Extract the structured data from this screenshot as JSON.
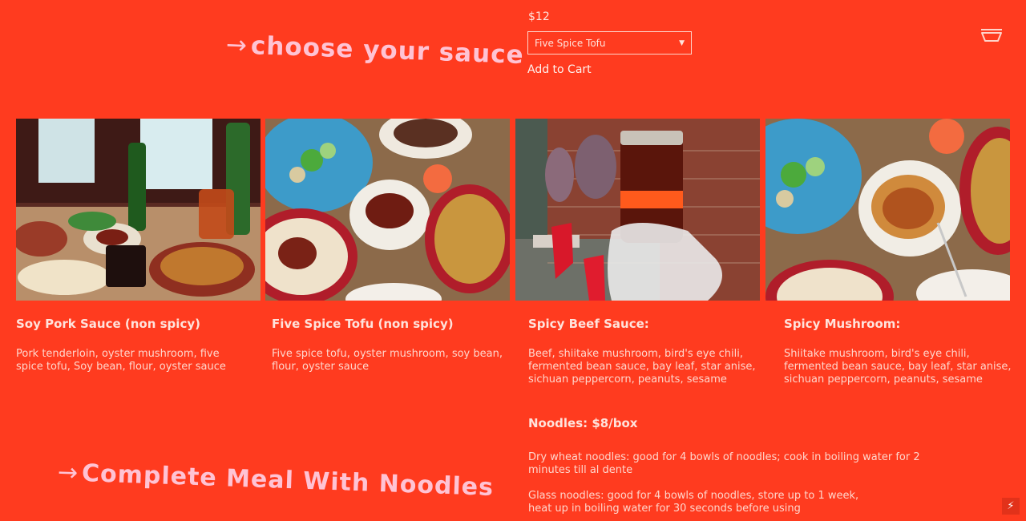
{
  "headings": {
    "arrow": "→",
    "sauce": "choose your sauce",
    "meal": "Complete Meal With Noodles"
  },
  "product": {
    "price": "$12",
    "selected_option": "Five Spice Tofu",
    "add_to_cart": "Add to Cart"
  },
  "icons": {
    "cart": "bowl-cart-icon",
    "badge": "lightning-icon"
  },
  "badge": {
    "glyph": "⚡"
  },
  "sauces": [
    {
      "title": "Soy Pork Sauce (non spicy)",
      "description": "Pork tenderloin, oyster mushroom, five spice tofu, Soy bean, flour, oyster sauce"
    },
    {
      "title": "Five Spice Tofu (non spicy)",
      "description": "Five spice tofu, oyster mushroom, soy bean, flour, oyster sauce"
    },
    {
      "title": "Spicy Beef Sauce:",
      "description": "Beef, shiitake mushroom, bird's eye chili, fermented bean sauce, bay leaf, star anise, sichuan peppercorn, peanuts, sesame"
    },
    {
      "title": "Spicy Mushroom:",
      "description": "Shiitake mushroom, bird's eye chili, fermented bean sauce, bay leaf, star anise, sichuan peppercorn, peanuts, sesame"
    }
  ],
  "noodles": {
    "title": "Noodles: $8/box",
    "dry_line1": "Dry wheat noodles: good for 4 bowls of noodles; cook in boiling water for 2",
    "dry_line2": "minutes till al dente",
    "glass_line1": "Glass noodles: good for 4 bowls of noodles, store up to 1 week,",
    "glass_line2": "heat up in boiling water for 30 seconds before using"
  },
  "colors": {
    "background": "#ff3b1f",
    "heading": "#ffc3d4",
    "text": "#ffe3dc"
  }
}
